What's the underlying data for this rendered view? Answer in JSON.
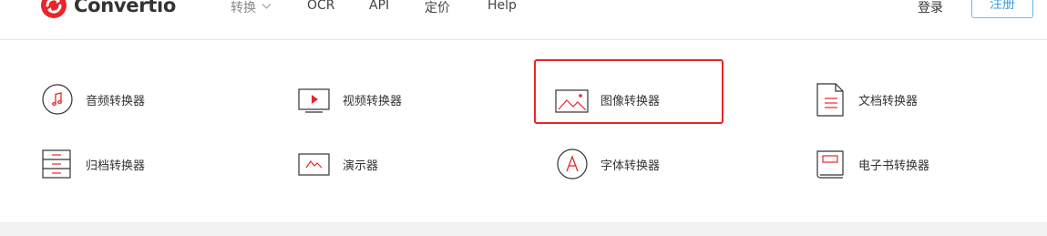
{
  "brand": {
    "name": "Convertio",
    "accent": "#e8262a"
  },
  "nav": {
    "convert": "转换",
    "ocr": "OCR",
    "api": "API",
    "pricing": "定价",
    "help": "Help"
  },
  "auth": {
    "login": "登录",
    "register": "注册"
  },
  "converters": [
    {
      "label": "音频转换器",
      "icon": "audio-icon"
    },
    {
      "label": "视频转换器",
      "icon": "video-icon"
    },
    {
      "label": "图像转换器",
      "icon": "image-icon"
    },
    {
      "label": "文档转换器",
      "icon": "document-icon"
    },
    {
      "label": "归档转换器",
      "icon": "archive-icon"
    },
    {
      "label": "演示器",
      "icon": "presentation-icon"
    },
    {
      "label": "字体转换器",
      "icon": "font-icon"
    },
    {
      "label": "电子书转换器",
      "icon": "ebook-icon"
    }
  ]
}
